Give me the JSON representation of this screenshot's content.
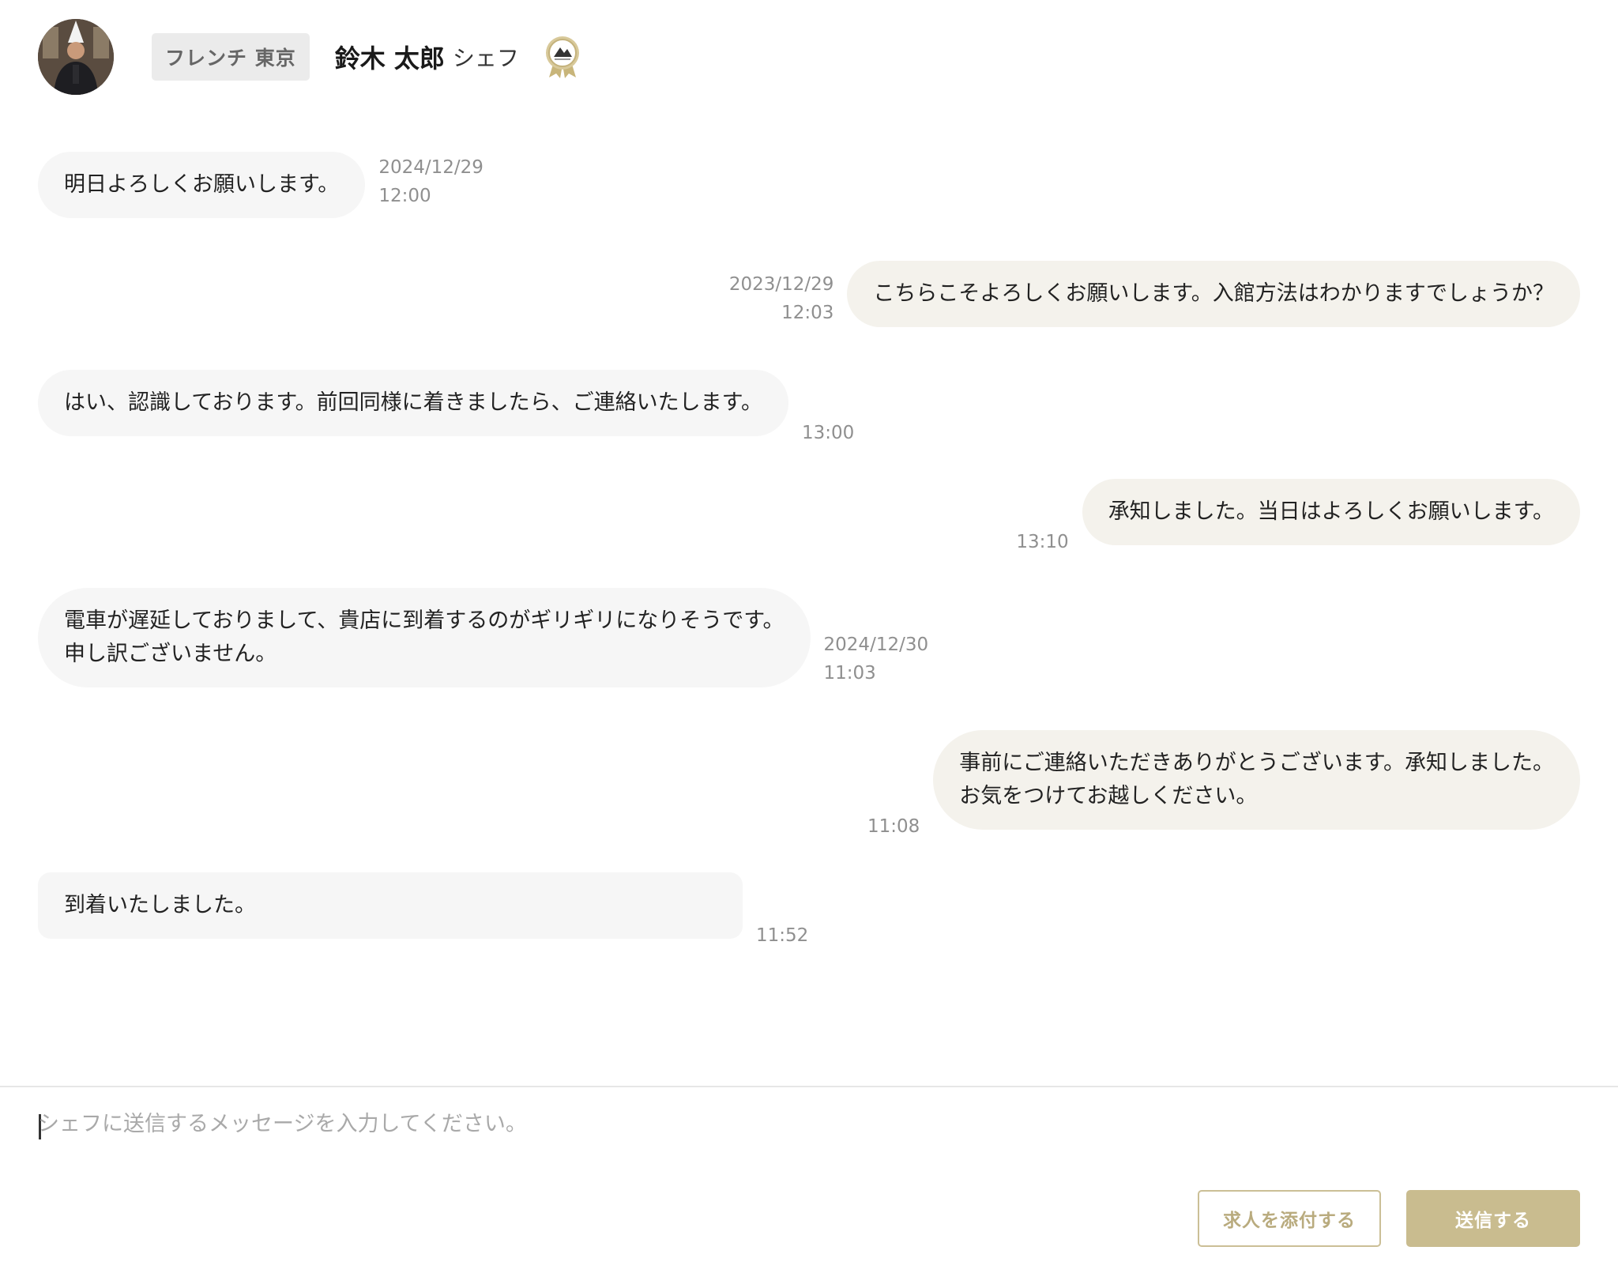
{
  "header": {
    "category": "フレンチ 東京",
    "chef_name": "鈴木 太郎",
    "chef_title": "シェフ",
    "avatar_icon": "chef-avatar",
    "badge_icon": "medal-icon"
  },
  "messages": [
    {
      "direction": "incoming",
      "lines": [
        "明日よろしくお願いします。"
      ],
      "date": "2024/12/29",
      "time": "12:00"
    },
    {
      "direction": "outgoing",
      "lines": [
        "こちらこそよろしくお願いします。入館方法はわかりますでしょうか？"
      ],
      "date": "2023/12/29",
      "time": "12:03"
    },
    {
      "direction": "incoming",
      "lines": [
        "はい、認識しております。前回同様に着きましたら、ご連絡いたします。"
      ],
      "date": "",
      "time": "13:00"
    },
    {
      "direction": "outgoing",
      "lines": [
        "承知しました。当日はよろしくお願いします。"
      ],
      "date": "",
      "time": "13:10"
    },
    {
      "direction": "incoming",
      "lines": [
        "電車が遅延しておりまして、貴店に到着するのがギリギリになりそうです。",
        "申し訳ございません。"
      ],
      "date": "2024/12/30",
      "time": "11:03"
    },
    {
      "direction": "outgoing",
      "lines": [
        "事前にご連絡いただきありがとうございます。承知しました。",
        "お気をつけてお越しください。"
      ],
      "date": "",
      "time": "11:08"
    },
    {
      "direction": "incoming",
      "lines": [
        "到着いたしました。"
      ],
      "date": "",
      "time": "11:52"
    }
  ],
  "composer": {
    "placeholder": "シェフに送信するメッセージを入力してください。",
    "value": ""
  },
  "actions": {
    "attach_label": "求人を添付する",
    "send_label": "送信する"
  },
  "colors": {
    "accent": "#c9bc8f",
    "incoming_bubble": "#f6f6f6",
    "outgoing_bubble": "#f4f2ec",
    "timestamp": "#8f8f8f"
  }
}
